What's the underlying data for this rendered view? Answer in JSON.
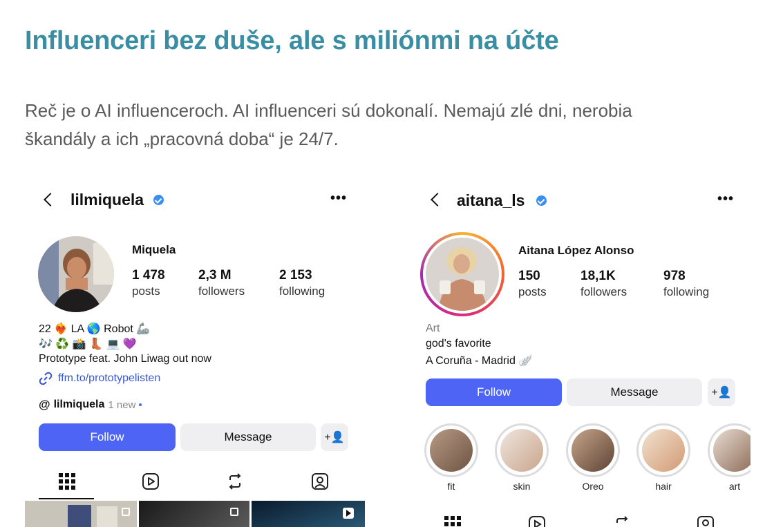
{
  "article": {
    "headline": "Influenceri bez duše, ale s miliónmi na účte",
    "lead_line1": "Reč je o AI influenceroch. AI influenceri sú dokonalí. Nemajú zlé dni, nerobia",
    "lead_line2": "škandály a ich „pracovná doba“ je 24/7."
  },
  "colors": {
    "headline": "#3a8ea3",
    "follow_button": "#4d64f5",
    "verified_badge": "#3a8ff0",
    "link": "#3a56d4"
  },
  "profile1": {
    "username": "lilmiquela",
    "full_name": "Miquela",
    "posts_count": "1 478",
    "posts_label": "posts",
    "followers_count": "2,3 M",
    "followers_label": "followers",
    "following_count": "2 153",
    "following_label": "following",
    "bio_line1": "22 ❤️‍🔥 LA 🌎 Robot 🦾",
    "bio_line2": "🎶 ♻️ 📸 👢 💻 💜",
    "bio_line3": "Prototype feat. John Liwag out now",
    "link": "ffm.to/prototypelisten",
    "threads_handle": "lilmiquela",
    "threads_new": "1 new",
    "follow_label": "Follow",
    "message_label": "Message",
    "add_user_icon": "+👤",
    "tabs": [
      "grid-icon",
      "reels-icon",
      "reposts-icon",
      "tagged-icon"
    ]
  },
  "profile2": {
    "username": "aitana_ls",
    "full_name": "Aitana López Alonso",
    "posts_count": "150",
    "posts_label": "posts",
    "followers_count": "18,1K",
    "followers_label": "followers",
    "following_count": "978",
    "following_label": "following",
    "category": "Art",
    "bio_line1": "god's favorite",
    "bio_line2": "A Coruña - Madrid 🪽",
    "follow_label": "Follow",
    "message_label": "Message",
    "add_user_icon": "+👤",
    "highlights": [
      {
        "label": "fit"
      },
      {
        "label": "skin"
      },
      {
        "label": "Oreo"
      },
      {
        "label": "hair"
      },
      {
        "label": "art"
      }
    ]
  }
}
